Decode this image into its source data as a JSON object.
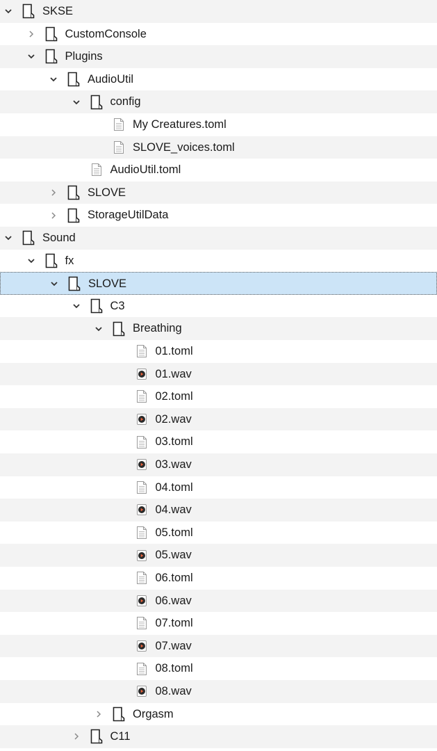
{
  "tree": [
    {
      "label": "SKSE",
      "depth": 0,
      "kind": "folder",
      "state": "expanded"
    },
    {
      "label": "CustomConsole",
      "depth": 1,
      "kind": "folder",
      "state": "collapsed"
    },
    {
      "label": "Plugins",
      "depth": 1,
      "kind": "folder",
      "state": "expanded"
    },
    {
      "label": "AudioUtil",
      "depth": 2,
      "kind": "folder",
      "state": "expanded"
    },
    {
      "label": "config",
      "depth": 3,
      "kind": "folder",
      "state": "expanded"
    },
    {
      "label": "My Creatures.toml",
      "depth": 4,
      "kind": "toml",
      "state": "none"
    },
    {
      "label": "SLOVE_voices.toml",
      "depth": 4,
      "kind": "toml",
      "state": "none"
    },
    {
      "label": "AudioUtil.toml",
      "depth": 3,
      "kind": "toml",
      "state": "none"
    },
    {
      "label": "SLOVE",
      "depth": 2,
      "kind": "folder",
      "state": "collapsed"
    },
    {
      "label": "StorageUtilData",
      "depth": 2,
      "kind": "folder",
      "state": "collapsed"
    },
    {
      "label": "Sound",
      "depth": 0,
      "kind": "folder",
      "state": "expanded"
    },
    {
      "label": "fx",
      "depth": 1,
      "kind": "folder",
      "state": "expanded"
    },
    {
      "label": "SLOVE",
      "depth": 2,
      "kind": "folder",
      "state": "expanded",
      "selected": true
    },
    {
      "label": "C3",
      "depth": 3,
      "kind": "folder",
      "state": "expanded"
    },
    {
      "label": "Breathing",
      "depth": 4,
      "kind": "folder",
      "state": "expanded"
    },
    {
      "label": "01.toml",
      "depth": 5,
      "kind": "toml",
      "state": "none"
    },
    {
      "label": "01.wav",
      "depth": 5,
      "kind": "wav",
      "state": "none"
    },
    {
      "label": "02.toml",
      "depth": 5,
      "kind": "toml",
      "state": "none"
    },
    {
      "label": "02.wav",
      "depth": 5,
      "kind": "wav",
      "state": "none"
    },
    {
      "label": "03.toml",
      "depth": 5,
      "kind": "toml",
      "state": "none"
    },
    {
      "label": "03.wav",
      "depth": 5,
      "kind": "wav",
      "state": "none"
    },
    {
      "label": "04.toml",
      "depth": 5,
      "kind": "toml",
      "state": "none"
    },
    {
      "label": "04.wav",
      "depth": 5,
      "kind": "wav",
      "state": "none"
    },
    {
      "label": "05.toml",
      "depth": 5,
      "kind": "toml",
      "state": "none"
    },
    {
      "label": "05.wav",
      "depth": 5,
      "kind": "wav",
      "state": "none"
    },
    {
      "label": "06.toml",
      "depth": 5,
      "kind": "toml",
      "state": "none"
    },
    {
      "label": "06.wav",
      "depth": 5,
      "kind": "wav",
      "state": "none"
    },
    {
      "label": "07.toml",
      "depth": 5,
      "kind": "toml",
      "state": "none"
    },
    {
      "label": "07.wav",
      "depth": 5,
      "kind": "wav",
      "state": "none"
    },
    {
      "label": "08.toml",
      "depth": 5,
      "kind": "toml",
      "state": "none"
    },
    {
      "label": "08.wav",
      "depth": 5,
      "kind": "wav",
      "state": "none"
    },
    {
      "label": "Orgasm",
      "depth": 4,
      "kind": "folder",
      "state": "collapsed"
    },
    {
      "label": "C11",
      "depth": 3,
      "kind": "folder",
      "state": "collapsed"
    }
  ],
  "icons": {
    "folder": "folder-icon",
    "toml": "text-file-icon",
    "wav": "audio-file-icon",
    "expanded": "chevron-down-icon",
    "collapsed": "chevron-right-icon"
  },
  "colors": {
    "selected_row": "#cce4f7",
    "alternate_row": "#f3f3f3"
  }
}
